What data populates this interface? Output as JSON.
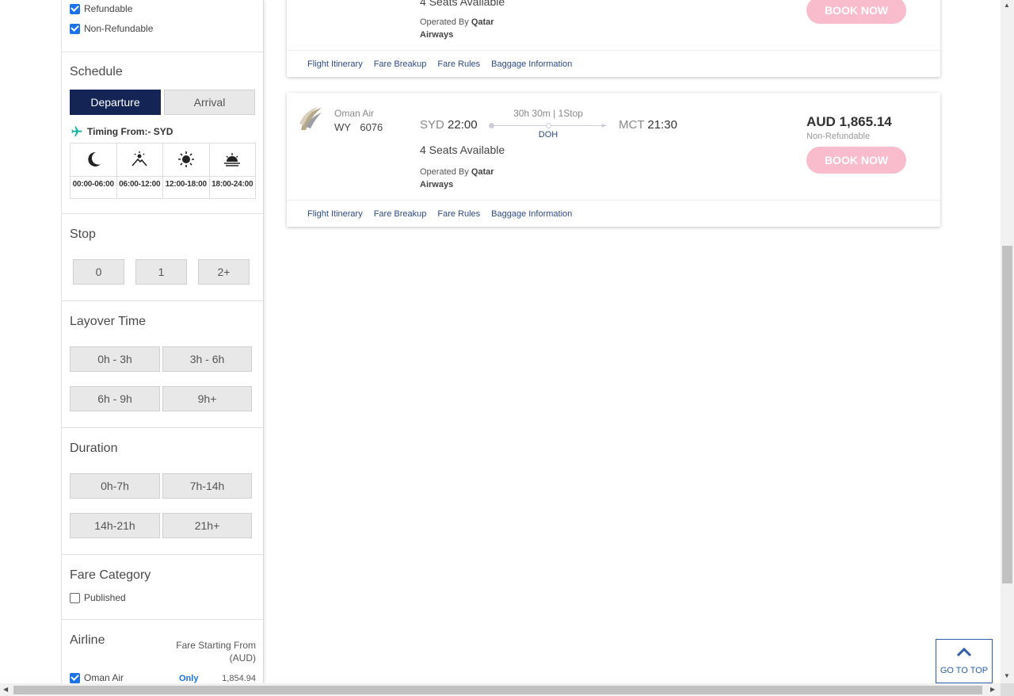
{
  "filters": {
    "refundable": {
      "label": "Refundable",
      "checked": true
    },
    "non_refundable": {
      "label": "Non-Refundable",
      "checked": true
    },
    "schedule": {
      "title": "Schedule",
      "departure": "Departure",
      "arrival": "Arrival",
      "timing_from": "Timing From:- SYD",
      "slots": [
        "00:00-06:00",
        "06:00-12:00",
        "12:00-18:00",
        "18:00-24:00"
      ]
    },
    "stop": {
      "title": "Stop",
      "options": [
        "0",
        "1",
        "2+"
      ]
    },
    "layover": {
      "title": "Layover Time",
      "options": [
        "0h - 3h",
        "3h - 6h",
        "6h - 9h",
        "9h+"
      ]
    },
    "duration": {
      "title": "Duration",
      "options": [
        "0h-7h",
        "7h-14h",
        "14h-21h",
        "21h+"
      ]
    },
    "fare_category": {
      "title": "Fare Category",
      "published": "Published"
    },
    "airline": {
      "title": "Airline",
      "fare_starting_line1": "Fare Starting From",
      "fare_starting_line2": "(AUD)",
      "items": [
        {
          "name": "Oman Air",
          "only": "Only",
          "price": "1,854.94"
        }
      ]
    }
  },
  "results": {
    "card1": {
      "seats": "4 Seats Available",
      "operated_by": "Operated By",
      "operator_line1": "Qatar",
      "operator_line2": "Airways",
      "book_label": "BOOK NOW"
    },
    "card2": {
      "airline_name": "Oman Air",
      "flight_code": "WY",
      "flight_number": "6076",
      "from_code": "SYD",
      "depart_time": "22:00",
      "duration_stops": "30h 30m | 1Stop",
      "via": "DOH",
      "to_code": "MCT",
      "arrive_time": "21:30",
      "seats": "4 Seats Available",
      "operated_by": "Operated By",
      "operator_line1": "Qatar",
      "operator_line2": "Airways",
      "price": "AUD 1,865.14",
      "fare_type": "Non-Refundable",
      "book_label": "BOOK NOW"
    },
    "links": [
      "Flight Itinerary",
      "Fare Breakup",
      "Fare Rules",
      "Baggage Information"
    ]
  },
  "go_to_top": "GO TO TOP",
  "colors": {
    "navy": "#132455",
    "book_pink": "#f9bccc",
    "link_blue": "#2d4a8a",
    "teal_plane": "#1bb5a4"
  }
}
